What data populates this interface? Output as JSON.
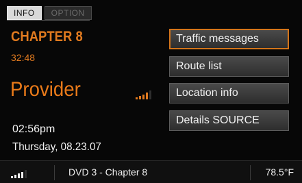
{
  "tabs": [
    {
      "label": "INFO",
      "active": true
    },
    {
      "label": "OPTION",
      "active": false
    }
  ],
  "media": {
    "chapter": "CHAPTER 8",
    "elapsed": "32:48"
  },
  "provider": {
    "label": "Provider",
    "signal_bars": 4,
    "signal_max": 5,
    "signal_color": "#e07a1f"
  },
  "clock": {
    "time": "02:56pm",
    "date": "Thursday, 08.23.07"
  },
  "menu": {
    "selected_index": 0,
    "items": [
      {
        "label": "Traffic messages"
      },
      {
        "label": "Route list"
      },
      {
        "label": "Location info"
      },
      {
        "label": "Details SOURCE"
      }
    ]
  },
  "statusbar": {
    "signal_bars": 4,
    "signal_max": 5,
    "track": "DVD 3 - Chapter 8",
    "temperature": "78.5°F"
  },
  "colors": {
    "accent": "#e07a1f",
    "background": "#070707",
    "text": "#f0f0f0"
  }
}
